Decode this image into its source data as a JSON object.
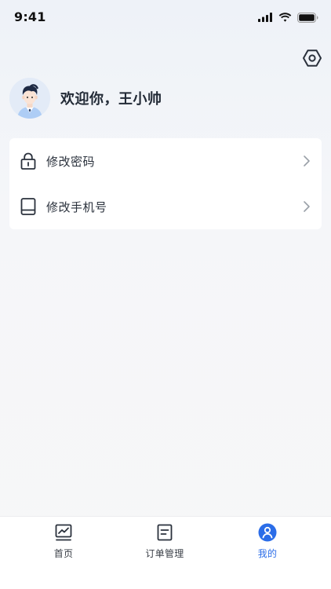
{
  "status_bar": {
    "time": "9:41",
    "icons": [
      "signal-icon",
      "wifi-icon",
      "battery-icon"
    ]
  },
  "header": {
    "settings_icon": "settings-hex-icon"
  },
  "profile": {
    "greeting": "欢迎你，王小帅",
    "avatar_icon": "user-avatar"
  },
  "menu": {
    "items": [
      {
        "label": "修改密码",
        "icon": "lock-icon"
      },
      {
        "label": "修改手机号",
        "icon": "phone-icon"
      }
    ]
  },
  "tab_bar": {
    "tabs": [
      {
        "label": "首页",
        "icon": "chart-icon",
        "active": false
      },
      {
        "label": "订单管理",
        "icon": "document-icon",
        "active": false
      },
      {
        "label": "我的",
        "icon": "user-circle-icon",
        "active": true
      }
    ]
  },
  "colors": {
    "accent": "#2b6de8",
    "text": "#2a313c",
    "card_background": "#ffffff"
  }
}
